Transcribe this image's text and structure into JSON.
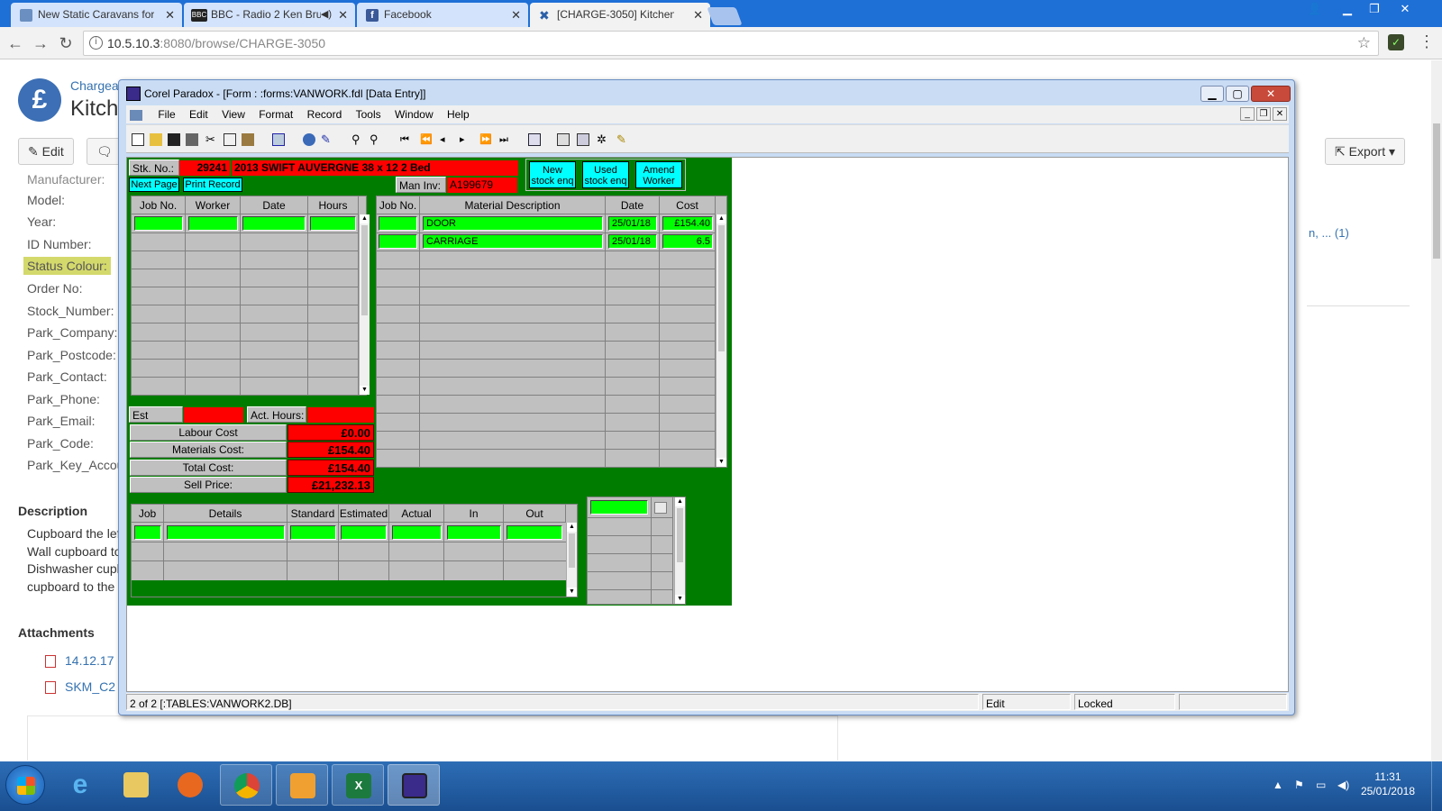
{
  "browser": {
    "tabs": [
      {
        "title": "New Static Caravans for",
        "favicon_color": "#6a8fc0"
      },
      {
        "title": "BBC - Radio 2 Ken Bru",
        "favicon_color": "#222222"
      },
      {
        "title": "Facebook",
        "favicon_color": "#3b5998"
      },
      {
        "title": "[CHARGE-3050] Kitchen",
        "favicon_color": "#2b5fa8"
      }
    ],
    "url_host": "10.5.10.3",
    "url_rest": ":8080/browse/CHARGE-3050"
  },
  "jira": {
    "logo_symbol": "£",
    "project": "Chargea",
    "title": "Kitch",
    "edit_label": "Edit",
    "export_label": "Export",
    "fields": [
      "Manufacturer:",
      "Model:",
      "Year:",
      "ID Number:",
      "Status Colour:",
      "Order No:",
      "Stock_Number:",
      "Park_Company:",
      "Park_Postcode:",
      "Park_Contact:",
      "Park_Phone:",
      "Park_Email:",
      "Park_Code:",
      "Park_Key_Accou"
    ],
    "side_link": "n,  ... (1)",
    "description_heading": "Description",
    "description_lines": [
      "Cupboard the lef",
      "Wall cupboard to",
      "Dishwasher cupb",
      "cupboard to the"
    ],
    "attachments_heading": "Attachments",
    "attachments": [
      "14.12.17",
      "SKM_C2"
    ]
  },
  "paradox": {
    "title": "Corel Paradox - [Form : :forms:VANWORK.fdl [Data Entry]]",
    "menu": [
      "File",
      "Edit",
      "View",
      "Format",
      "Record",
      "Tools",
      "Window",
      "Help"
    ],
    "form": {
      "stk_label": "Stk. No.:",
      "stk_value": "29241",
      "van_desc": "2013 SWIFT AUVERGNE 38 x 12 2 Bed",
      "man_inv_label": "Man Inv:",
      "man_inv_value": "A199679",
      "next_page": "Next Page",
      "print_record": "Print Record",
      "btn_new_stock": "New stock enq",
      "btn_used_stock": "Used stock enq",
      "btn_amend_worker": "Amend Worker",
      "labour_headers": [
        "Job No.",
        "Worker",
        "Date",
        "Hours"
      ],
      "material_headers": [
        "Job No.",
        "Material Description",
        "Date",
        "Cost"
      ],
      "materials": [
        {
          "job": "",
          "desc": "DOOR",
          "date": "25/01/18",
          "cost": "£154.40"
        },
        {
          "job": "",
          "desc": "CARRIAGE",
          "date": "25/01/18",
          "cost": "6.5"
        }
      ],
      "est_hours_label": "Est Hours:",
      "act_hours_label": "Act. Hours:",
      "labour_cost_label": "Labour Cost",
      "labour_cost": "£0.00",
      "materials_cost_label": "Materials Cost:",
      "materials_cost": "£154.40",
      "total_cost_label": "Total Cost:",
      "total_cost": "£154.40",
      "sell_price_label": "Sell Price:",
      "sell_price": "£21,232.13",
      "job_headers": [
        "Job",
        "Details",
        "Standard",
        "Estimated",
        "Actual",
        "In",
        "Out"
      ]
    },
    "status": {
      "record": "2 of 2 [:TABLES:VANWORK2.DB]",
      "mode": "Edit",
      "lock": "Locked"
    }
  },
  "taskbar": {
    "time": "11:31",
    "date": "25/01/2018"
  },
  "colors": {
    "form_green": "#007d00",
    "field_red": "#ff0000",
    "field_green": "#00ff00",
    "button_cyan": "#00ffff"
  }
}
